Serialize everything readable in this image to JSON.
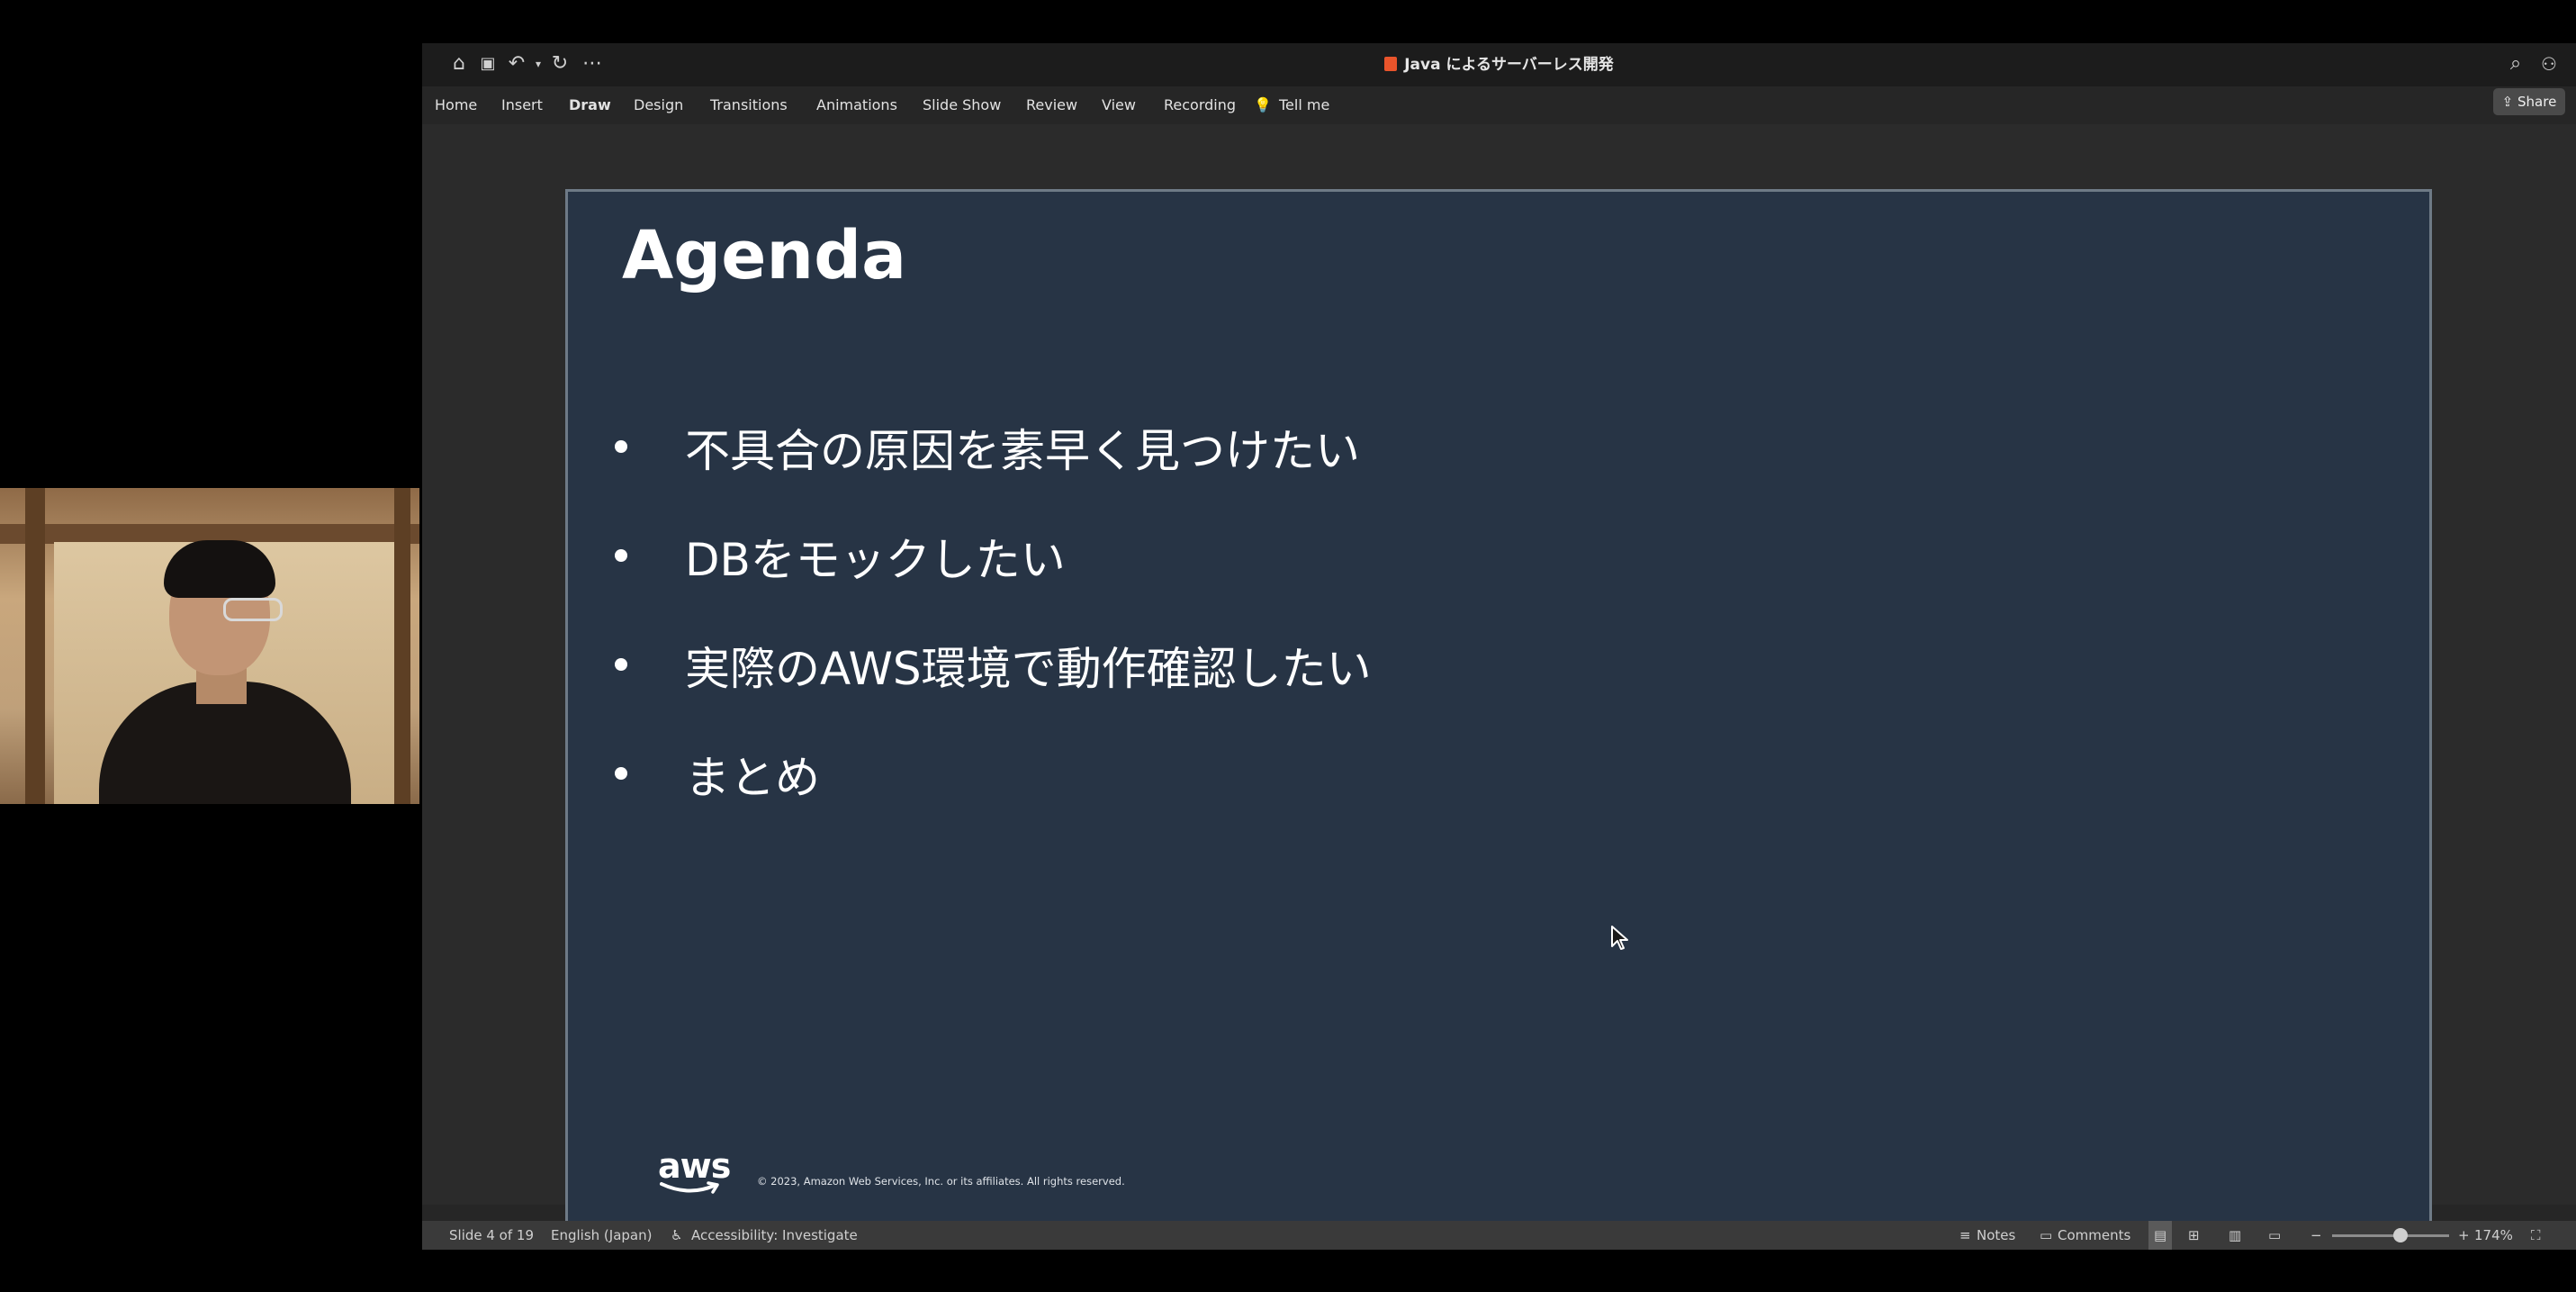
{
  "app": {
    "document_title": "Java によるサーバーレス開発",
    "ribbon_tabs": [
      "Home",
      "Insert",
      "Draw",
      "Design",
      "Transitions",
      "Animations",
      "Slide Show",
      "Review",
      "View",
      "Recording"
    ],
    "tell_me": "Tell me",
    "share": "Share"
  },
  "slide": {
    "title": "Agenda",
    "bullets": [
      "不具合の原因を素早く見つけたい",
      "DBをモックしたい",
      "実際のAWS環境で動作確認したい",
      "まとめ"
    ],
    "logo_text": "aws",
    "copyright": "© 2023, Amazon Web Services, Inc. or its affiliates. All rights reserved."
  },
  "statusbar": {
    "slide_position": "Slide 4 of 19",
    "language": "English (Japan)",
    "accessibility": "Accessibility: Investigate",
    "notes": "Notes",
    "comments": "Comments",
    "zoom": "174%"
  },
  "colors": {
    "slide_background": "#273445",
    "window_background": "#262626",
    "titlebar": "#1c1c1c"
  },
  "icons": [
    "home-icon",
    "save-icon",
    "undo-icon",
    "redo-icon",
    "more-icon",
    "search-icon",
    "account-icon",
    "lightbulb-icon",
    "share-icon",
    "accessibility-icon",
    "notes-icon",
    "comments-icon",
    "normal-view-icon",
    "slide-sorter-icon",
    "reading-view-icon",
    "slideshow-icon",
    "fit-slide-icon"
  ]
}
